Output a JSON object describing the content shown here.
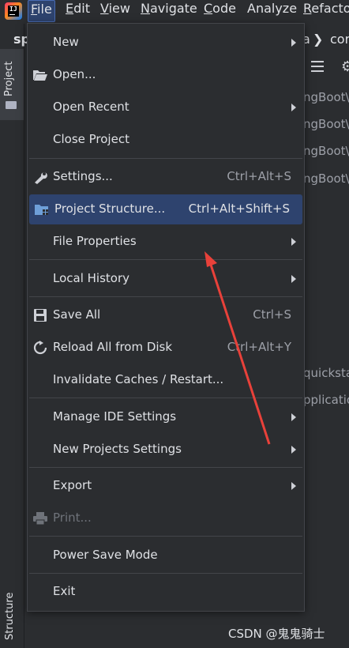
{
  "menubar": {
    "items": [
      {
        "label": "File",
        "mnemonic_rest": "ile",
        "mnemonic": "F"
      },
      {
        "label": "Edit",
        "mnemonic": "E",
        "mnemonic_rest": "dit"
      },
      {
        "label": "View",
        "mnemonic": "V",
        "mnemonic_rest": "iew"
      },
      {
        "label": "Navigate",
        "mnemonic": "N",
        "mnemonic_rest": "avigate"
      },
      {
        "label": "Code",
        "mnemonic": "C",
        "mnemonic_rest": "ode"
      },
      {
        "label": "Analyze",
        "mnemonic": "",
        "mnemonic_rest": "Analyze"
      },
      {
        "label": "Refactor",
        "mnemonic": "R",
        "mnemonic_rest": "efactor"
      }
    ]
  },
  "left_stripe": {
    "project_label": "Project",
    "structure_label": "Structure"
  },
  "background": {
    "project_name": "sp",
    "breadcrumb_a": "a",
    "breadcrumb_chevron": "❯",
    "breadcrumb_con": "cor",
    "tree_lines": [
      "ngBoot\\",
      "ngBoot\\",
      "ngBoot\\",
      "ngBoot\\",
      "quicksta",
      "pplicatio"
    ]
  },
  "dropdown": {
    "items": [
      {
        "id": "new",
        "label": "New",
        "shortcut": "",
        "submenu": true,
        "icon": "",
        "disabled": false,
        "selected": false
      },
      {
        "id": "open",
        "label": "Open...",
        "shortcut": "",
        "submenu": false,
        "icon": "folder-open-icon",
        "disabled": false,
        "selected": false
      },
      {
        "id": "open-recent",
        "label": "Open Recent",
        "shortcut": "",
        "submenu": true,
        "icon": "",
        "disabled": false,
        "selected": false
      },
      {
        "id": "close-project",
        "label": "Close Project",
        "shortcut": "",
        "submenu": false,
        "icon": "",
        "disabled": false,
        "selected": false
      },
      {
        "id": "settings",
        "label": "Settings...",
        "shortcut": "Ctrl+Alt+S",
        "submenu": false,
        "icon": "wrench-icon",
        "disabled": false,
        "selected": false
      },
      {
        "id": "project-structure",
        "label": "Project Structure...",
        "shortcut": "Ctrl+Alt+Shift+S",
        "submenu": false,
        "icon": "project-structure-icon",
        "disabled": false,
        "selected": true
      },
      {
        "id": "file-properties",
        "label": "File Properties",
        "shortcut": "",
        "submenu": true,
        "icon": "",
        "disabled": false,
        "selected": false
      },
      {
        "id": "local-history",
        "label": "Local History",
        "shortcut": "",
        "submenu": true,
        "icon": "",
        "disabled": false,
        "selected": false
      },
      {
        "id": "save-all",
        "label": "Save All",
        "shortcut": "Ctrl+S",
        "submenu": false,
        "icon": "save-icon",
        "disabled": false,
        "selected": false
      },
      {
        "id": "reload-all",
        "label": "Reload All from Disk",
        "shortcut": "Ctrl+Alt+Y",
        "submenu": false,
        "icon": "reload-icon",
        "disabled": false,
        "selected": false
      },
      {
        "id": "invalidate-caches",
        "label": "Invalidate Caches / Restart...",
        "shortcut": "",
        "submenu": false,
        "icon": "",
        "disabled": false,
        "selected": false
      },
      {
        "id": "manage-ide-settings",
        "label": "Manage IDE Settings",
        "shortcut": "",
        "submenu": true,
        "icon": "",
        "disabled": false,
        "selected": false
      },
      {
        "id": "new-projects-settings",
        "label": "New Projects Settings",
        "shortcut": "",
        "submenu": true,
        "icon": "",
        "disabled": false,
        "selected": false
      },
      {
        "id": "export",
        "label": "Export",
        "shortcut": "",
        "submenu": true,
        "icon": "",
        "disabled": false,
        "selected": false
      },
      {
        "id": "print",
        "label": "Print...",
        "shortcut": "",
        "submenu": false,
        "icon": "printer-icon",
        "disabled": true,
        "selected": false
      },
      {
        "id": "power-save-mode",
        "label": "Power Save Mode",
        "shortcut": "",
        "submenu": false,
        "icon": "",
        "disabled": false,
        "selected": false
      },
      {
        "id": "exit",
        "label": "Exit",
        "shortcut": "",
        "submenu": false,
        "icon": "",
        "disabled": false,
        "selected": false
      }
    ]
  },
  "annotation": {
    "arrow_color": "#e8413a"
  },
  "watermark": "CSDN @鬼鬼骑士",
  "colors": {
    "background": "#2b2d30",
    "selection": "#2e436e",
    "text": "#dfe1e5",
    "muted": "#9da0a8",
    "separator": "#43454a"
  }
}
